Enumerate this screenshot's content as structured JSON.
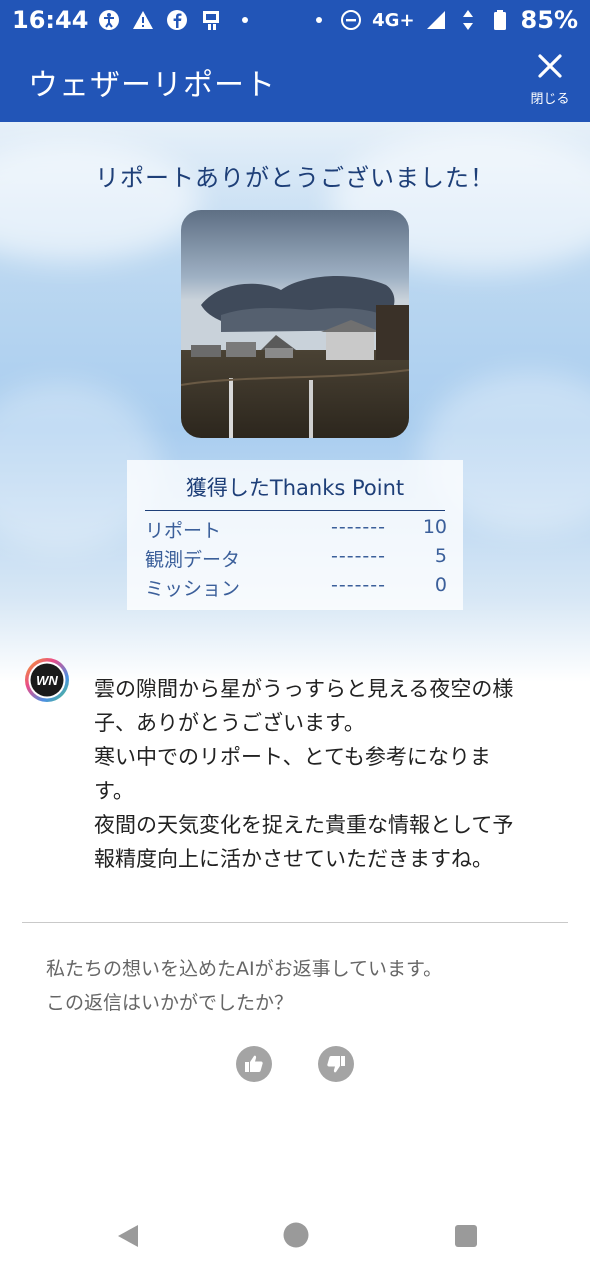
{
  "status_bar": {
    "time": "16:44",
    "network": "4G+",
    "battery": "85%"
  },
  "app_bar": {
    "title": "ウェザーリポート",
    "close_label": "閉じる"
  },
  "report": {
    "thanks_message": "リポートありがとうございました！",
    "points_title": "獲得したThanks Point",
    "points": [
      {
        "label": "リポート",
        "dashes": "-------",
        "value": "10"
      },
      {
        "label": "観測データ",
        "dashes": "-------",
        "value": "5"
      },
      {
        "label": "ミッション",
        "dashes": "-------",
        "value": "0"
      }
    ]
  },
  "ai_reply": {
    "lines": [
      "雲の隙間から星がうっすらと見える夜空の様",
      "子、ありがとうございます。",
      "寒い中でのリポート、とても参考になりま",
      "す。",
      "夜間の天気変化を捉えた貴重な情報として予",
      "報精度向上に活かさせていただきますね。"
    ],
    "avatar_text": "WN"
  },
  "feedback": {
    "line1": "私たちの想いを込めたAIがお返事しています。",
    "line2": "この返信はいかがでしたか？"
  },
  "colors": {
    "brand_blue": "#2255b7",
    "title_navy": "#1e3f78"
  }
}
